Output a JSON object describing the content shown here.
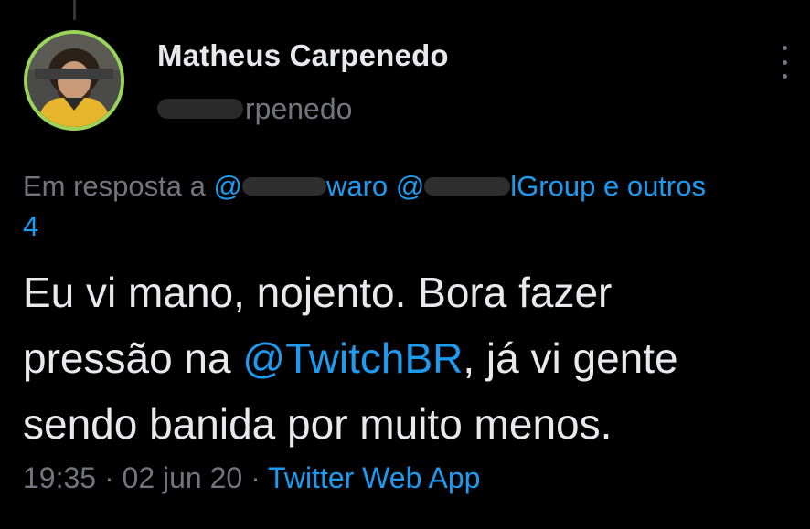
{
  "tweet": {
    "author_name": "Matheus Carpenedo",
    "handle_visible": "rpenedo",
    "reply_prefix": "Em resposta a",
    "reply_mention_1": "waro",
    "reply_mention_2": "lGroup",
    "reply_suffix": "e outros",
    "reply_count": "4",
    "text_line_1": "Eu vi mano, nojento. Bora fazer",
    "text_line_2_pre": "pressão na ",
    "text_mention": "@TwitchBR",
    "text_line_2_post": ", já vi gente",
    "text_line_3": "sendo banida por muito menos.",
    "time": "19:35",
    "date": "02 jun 20",
    "separator": "·",
    "source": "Twitter Web App"
  },
  "colors": {
    "background": "#000000",
    "text": "#e7e9ea",
    "muted": "#71767b",
    "link": "#1d9bf0",
    "avatar_ring": "#9ad45a"
  },
  "icons": {
    "more": "more-vertical-icon"
  }
}
